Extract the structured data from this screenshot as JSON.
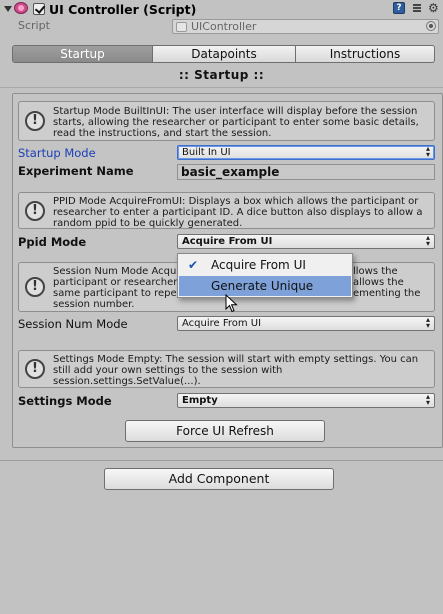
{
  "header": {
    "title": "UI Controller (Script)",
    "enabled": true,
    "help_icon_glyph": "?"
  },
  "script_row": {
    "label": "Script",
    "value": "UIController"
  },
  "tabs": [
    {
      "label": "Startup",
      "active": true
    },
    {
      "label": "Datapoints",
      "active": false
    },
    {
      "label": "Instructions",
      "active": false
    }
  ],
  "section_title": "::  Startup  ::",
  "helpboxes": {
    "startup": "Startup Mode BuiltInUI: The user interface will display before the session starts, allowing the researcher or participant to enter some basic details, read the instructions, and start the session.",
    "ppid": "PPID Mode AcquireFromUI: Displays a box which allows the participant or researcher to enter a participant ID. A dice button also displays to allow a random ppid to be quickly generated.",
    "session_left": "Session Num Mode Acqu",
    "session_left2": "participant or researcher",
    "session_left3": "same participant to repe",
    "session_left4": "session number.",
    "session_right": "llows the",
    "session_right2": "allows the",
    "session_right3": "ementing the",
    "settings": "Settings Mode Empty: The session will start with empty settings. You can still add your own settings to the session with session.settings.SetValue(...).",
    "info_glyph": "!"
  },
  "fields": {
    "startup_mode": {
      "label": "Startup Mode",
      "value": "Built In UI"
    },
    "experiment_name": {
      "label": "Experiment Name",
      "value": "basic_example"
    },
    "ppid_mode": {
      "label": "Ppid Mode",
      "value": "Acquire From UI"
    },
    "session_num_mode": {
      "label": "Session Num Mode",
      "value": "Acquire From UI"
    },
    "settings_mode": {
      "label": "Settings Mode",
      "value": "Empty"
    }
  },
  "dropdown": {
    "options": [
      {
        "label": "Acquire From UI",
        "checked": true,
        "highlighted": false
      },
      {
        "label": "Generate Unique",
        "checked": false,
        "highlighted": true
      }
    ],
    "check_glyph": "✔"
  },
  "buttons": {
    "force_ui_refresh": "Force UI Refresh",
    "add_component": "Add Component"
  },
  "popup_arrow_glyph": "▲▼",
  "colors": {
    "accent_blue": "#1a3fb8",
    "highlight": "#7da1d8",
    "active_tab": "#959595"
  }
}
